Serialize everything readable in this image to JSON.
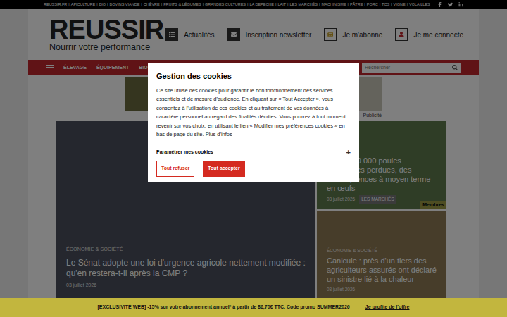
{
  "top_bar": {
    "separator": "|",
    "links": [
      "REUSSIR.FR",
      "APICULTURE",
      "BIO",
      "BOVINS VIANDE",
      "CHÈVRE",
      "FRUITS & LÉGUMES",
      "GRANDES CULTURES",
      "LA DEPECHE",
      "LAIT",
      "LES MARCHÉS",
      "MACHINISME",
      "PÂTRE",
      "PORC",
      "TCS",
      "VIGNE",
      "VOLAILLES"
    ]
  },
  "header": {
    "logo": "REUSSIR",
    "tagline": "Nourrir votre performance",
    "actions": [
      {
        "label": "Actualités",
        "kind": "list"
      },
      {
        "label": "Inscription newsletter",
        "kind": "mail"
      },
      {
        "label": "Je m'abonne",
        "kind": "subscribe"
      },
      {
        "label": "Je me connecte",
        "kind": "user"
      }
    ]
  },
  "nav": {
    "items": [
      "ÉLEVAGE",
      "ÉQUIPEMENT",
      "BIO"
    ],
    "search": {
      "placeholder": "Rechercher"
    }
  },
  "ads": {
    "label": "Publicité"
  },
  "featured": {
    "category": "ÉCONOMIE & SOCIÉTÉ",
    "title": "Le Sénat adopte une loi d'urgence agricole nettement modifiée : qu'en restera-t-il après la CMP ?",
    "date": "03 juillet 2026"
  },
  "side_articles": [
    {
      "category": "",
      "title": "500 à 700 000 poules pondeuses perdues, des conséquences à moyen terme en œufs",
      "date": "03 juillet 2026",
      "tag": "LES MARCHÉS",
      "badge": "Membres",
      "color": "#5f7a4c"
    },
    {
      "category": "ÉCONOMIE & SOCIÉTÉ",
      "title": "Canicule : près d'un tiers des agriculteurs assurés ont déclaré un sinistre lié à la chaleur",
      "date": "03 juillet 2026",
      "tag": "",
      "badge": "",
      "color": "#8e7b55"
    }
  ],
  "cookie_modal": {
    "title": "Gestion des cookies",
    "text": "Ce site utilise des cookies pour garantir le bon fonctionnement des services essentiels et de mesure d'audience. En cliquant sur « Tout Accepter », vous consentez à l'utilisation de ces cookies et au traitement de vos données à caractère personnel au regard des finalités décrites. Vous pourrez à tout moment revenir sur vos choix, en utilisant le lien « Modifier mes préférences cookies » en bas de page du site.",
    "link": "Plus d'infos",
    "settings": {
      "label": "Paramétrer mes cookies",
      "expand": "+",
      "expanded": false
    },
    "buttons": [
      {
        "label": "Tout refuser",
        "kind": "outline"
      },
      {
        "label": "Tout accepter",
        "kind": "filled"
      }
    ]
  },
  "promo_banner": {
    "text": "[EXCLUSIVITÉ WEB] -15% sur votre abonnement annuel* à partir de 86,70€ TTC. Code promo SUMMER2026",
    "link": "Je profite de l'offre"
  }
}
